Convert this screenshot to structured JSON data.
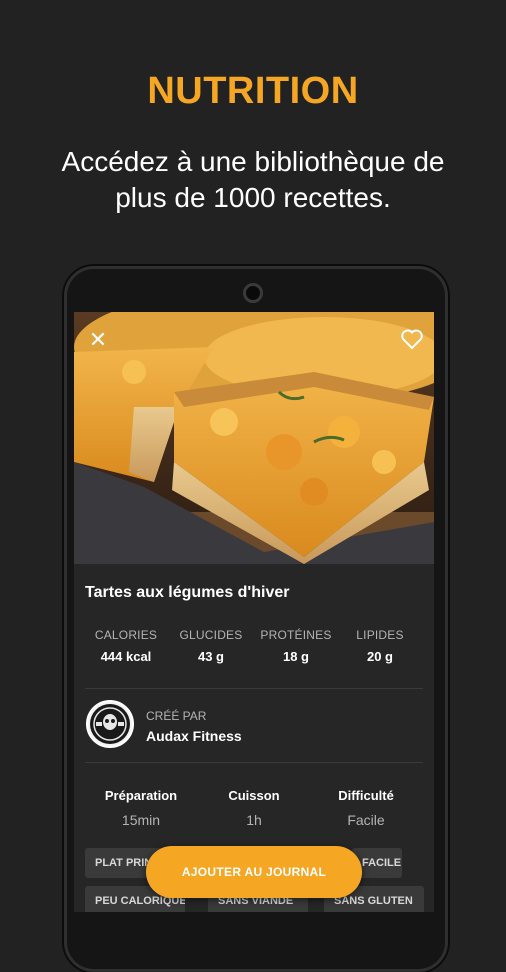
{
  "promo": {
    "headline": "NUTRITION",
    "subline": "Accédez à une bibliothèque de plus de 1000 recettes."
  },
  "recipe": {
    "title": "Tartes aux légumes d'hiver",
    "photo_icon": "quiche-photo",
    "close_icon": "close-icon",
    "favorite_icon": "heart-icon",
    "macros": [
      {
        "label": "CALORIES",
        "value": "444 kcal"
      },
      {
        "label": "GLUCIDES",
        "value": "43 g"
      },
      {
        "label": "PROTÉINES",
        "value": "18 g"
      },
      {
        "label": "LIPIDES",
        "value": "20 g"
      }
    ],
    "creator": {
      "label": "CRÉÉ PAR",
      "name": "Audax Fitness"
    },
    "info": [
      {
        "label": "Préparation",
        "value": "15min"
      },
      {
        "label": "Cuisson",
        "value": "1h"
      },
      {
        "label": "Difficulté",
        "value": "Facile"
      }
    ],
    "tags": [
      "PLAT PRINCIPAL",
      "FACILE",
      "PEU CALORIQUE",
      "SANS VIANDE",
      "SANS GLUTEN"
    ]
  },
  "actions": {
    "add_to_journal": "AJOUTER AU JOURNAL"
  },
  "colors": {
    "accent": "#F5A623",
    "background": "#222222",
    "screen": "#262626"
  }
}
